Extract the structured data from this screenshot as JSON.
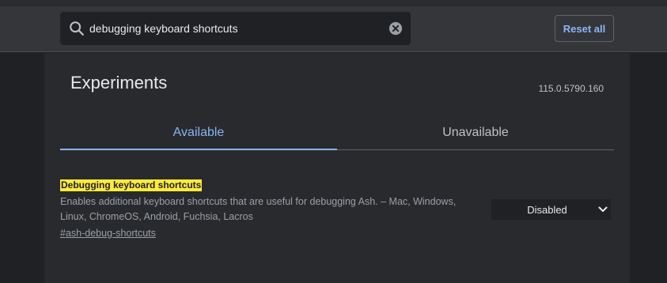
{
  "search": {
    "value": "debugging keyboard shortcuts",
    "icon": "search-icon",
    "clear_icon": "close-circle-icon"
  },
  "header": {
    "reset_label": "Reset all"
  },
  "page": {
    "title": "Experiments",
    "version": "115.0.5790.160"
  },
  "tabs": [
    {
      "label": "Available",
      "selected": true
    },
    {
      "label": "Unavailable",
      "selected": false
    }
  ],
  "experiment": {
    "name": "Debugging keyboard shortcuts",
    "description": "Enables additional keyboard shortcuts that are useful for debugging Ash. – Mac, Windows, Linux, ChromeOS, Android, Fuchsia, Lacros",
    "link": "#ash-debug-shortcuts",
    "selected_option": "Disabled"
  },
  "colors": {
    "accent": "#8ab4f8",
    "highlight": "#ffeb3b",
    "background": "#202124",
    "panel": "#292a2d"
  }
}
